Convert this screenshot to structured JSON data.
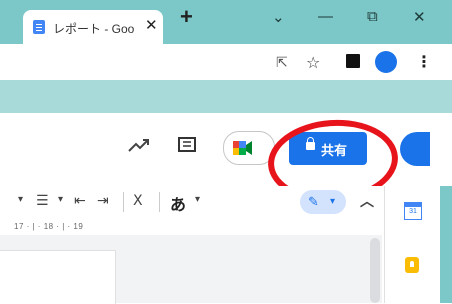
{
  "browser": {
    "tab_title": "レポート - Goo",
    "tab_close": "✕",
    "new_tab": "+",
    "window_controls": [
      "⌄",
      "—",
      "⧉",
      "✕"
    ],
    "addr_icons": [
      "⇱",
      "☆",
      "■",
      "●",
      "⋮"
    ]
  },
  "docs_toolbar": {
    "icons": [
      "trending-up-icon",
      "comment-icon",
      "meet-icon"
    ],
    "share_label": "共有",
    "accent_color": "#1a73e8"
  },
  "format_bar": {
    "items": [
      "▾",
      "☰",
      "▾",
      "⇤",
      "⇥",
      "Ⅹ",
      "あ",
      "▾",
      "✎",
      "▾",
      "︿"
    ],
    "ruler_text": "17 · | · 18 · | · 19"
  },
  "side_panel": {
    "icons": [
      "calendar-icon",
      "keep-icon"
    ],
    "calendar_day": "31"
  },
  "annotation": {
    "color": "#e8141c"
  }
}
